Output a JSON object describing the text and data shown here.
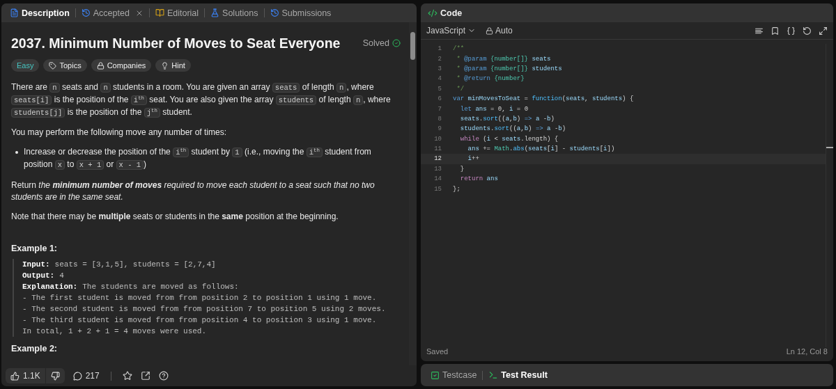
{
  "left_tabs": [
    {
      "kind": "description",
      "label": "Description",
      "selected": true,
      "closable": false
    },
    {
      "kind": "accepted",
      "label": "Accepted",
      "selected": false,
      "closable": true
    },
    {
      "kind": "editorial",
      "label": "Editorial",
      "selected": false,
      "closable": false
    },
    {
      "kind": "solutions",
      "label": "Solutions",
      "selected": false,
      "closable": false
    },
    {
      "kind": "submissions",
      "label": "Submissions",
      "selected": false,
      "closable": false
    }
  ],
  "problem": {
    "title": "2037. Minimum Number of Moves to Seat Everyone",
    "status": "Solved",
    "difficulty": "Easy",
    "chips": [
      {
        "kind": "topics",
        "label": "Topics"
      },
      {
        "kind": "companies",
        "label": "Companies"
      },
      {
        "kind": "hint",
        "label": "Hint"
      }
    ],
    "paragraphs": [
      {
        "kind": "para",
        "segments": [
          {
            "kind": "text",
            "t": "There are "
          },
          {
            "kind": "code",
            "t": "n"
          },
          {
            "kind": "text",
            "t": " seats and "
          },
          {
            "kind": "code",
            "t": "n"
          },
          {
            "kind": "text",
            "t": " students in a room. You are given an array "
          },
          {
            "kind": "code",
            "t": "seats"
          },
          {
            "kind": "text",
            "t": " of length "
          },
          {
            "kind": "code",
            "t": "n"
          },
          {
            "kind": "text",
            "t": ", where "
          },
          {
            "kind": "code",
            "t": "seats[i]"
          },
          {
            "kind": "text",
            "t": " is the position of the "
          },
          {
            "kind": "code",
            "t": "i$^{th}$"
          },
          {
            "kind": "text",
            "t": " seat. You are also given the array "
          },
          {
            "kind": "code",
            "t": "students"
          },
          {
            "kind": "text",
            "t": " of length "
          },
          {
            "kind": "code",
            "t": "n"
          },
          {
            "kind": "text",
            "t": ", where "
          },
          {
            "kind": "code",
            "t": "students[j]"
          },
          {
            "kind": "text",
            "t": " is the position of the "
          },
          {
            "kind": "code",
            "t": "j$^{th}$"
          },
          {
            "kind": "text",
            "t": " student."
          }
        ]
      },
      {
        "kind": "para",
        "segments": [
          {
            "kind": "text",
            "t": "You may perform the following move any number of times:"
          }
        ]
      },
      {
        "kind": "bullet",
        "segments": [
          {
            "kind": "text",
            "t": "Increase or decrease the position of the "
          },
          {
            "kind": "code",
            "t": "i$^{th}$"
          },
          {
            "kind": "text",
            "t": " student by "
          },
          {
            "kind": "code",
            "t": "1"
          },
          {
            "kind": "text",
            "t": " (i.e., moving the "
          },
          {
            "kind": "code",
            "t": "i$^{th}$"
          },
          {
            "kind": "text",
            "t": " student from position "
          },
          {
            "kind": "code",
            "t": "x"
          },
          {
            "kind": "text",
            "t": " to "
          },
          {
            "kind": "code",
            "t": "x + 1"
          },
          {
            "kind": "text",
            "t": " or "
          },
          {
            "kind": "code",
            "t": "x - 1"
          },
          {
            "kind": "text",
            "t": ")"
          }
        ]
      },
      {
        "kind": "para",
        "segments": [
          {
            "kind": "text",
            "t": "Return "
          },
          {
            "kind": "italic",
            "t": "the "
          },
          {
            "kind": "bolditalic",
            "t": "minimum number of moves"
          },
          {
            "kind": "italic",
            "t": " required to move each student to a seat such that no two students are in the same seat."
          }
        ]
      },
      {
        "kind": "para",
        "segments": [
          {
            "kind": "text",
            "t": "Note that there may be "
          },
          {
            "kind": "bold",
            "t": "multiple"
          },
          {
            "kind": "text",
            "t": " seats or students in the "
          },
          {
            "kind": "bold",
            "t": "same"
          },
          {
            "kind": "text",
            "t": " position at the beginning."
          }
        ]
      }
    ],
    "examples": [
      {
        "title": "Example 1:",
        "lines": [
          {
            "label": "Input:",
            "text": "seats = [3,1,5], students = [2,7,4]"
          },
          {
            "label": "Output:",
            "text": "4"
          },
          {
            "label": "Explanation:",
            "text": "The students are moved as follows:"
          },
          {
            "text": "- The first student is moved from from position 2 to position 1 using 1 move."
          },
          {
            "text": "- The second student is moved from from position 7 to position 5 using 2 moves."
          },
          {
            "text": "- The third student is moved from from position 4 to position 3 using 1 move."
          },
          {
            "text": "In total, 1 + 2 + 1 = 4 moves were used."
          }
        ]
      }
    ],
    "next_heading": "Example 2:"
  },
  "footer": {
    "likes": "1.1K",
    "comments": "217"
  },
  "editor": {
    "title": "Code",
    "language": "JavaScript",
    "mode": "Auto",
    "status": "Saved",
    "cursor": "Ln 12, Col 8",
    "lines": [
      {
        "number": "1",
        "current": false,
        "tokens": [
          {
            "kind": "comment",
            "t": "/**"
          }
        ]
      },
      {
        "number": "2",
        "current": false,
        "tokens": [
          {
            "kind": "comment",
            "t": " * "
          },
          {
            "kind": "tag",
            "t": "@param"
          },
          {
            "kind": "type",
            "t": " {number[]}"
          },
          {
            "kind": "var",
            "t": " seats"
          }
        ]
      },
      {
        "number": "3",
        "current": false,
        "tokens": [
          {
            "kind": "comment",
            "t": " * "
          },
          {
            "kind": "tag",
            "t": "@param"
          },
          {
            "kind": "type",
            "t": " {number[]}"
          },
          {
            "kind": "var",
            "t": " students"
          }
        ]
      },
      {
        "number": "4",
        "current": false,
        "tokens": [
          {
            "kind": "comment",
            "t": " * "
          },
          {
            "kind": "tag",
            "t": "@return"
          },
          {
            "kind": "type",
            "t": " {number}"
          }
        ]
      },
      {
        "number": "5",
        "current": false,
        "tokens": [
          {
            "kind": "comment",
            "t": " */"
          }
        ]
      },
      {
        "number": "6",
        "current": false,
        "tokens": [
          {
            "kind": "keyword",
            "t": "var"
          },
          {
            "kind": "var",
            "t": " minMovesToSeat"
          },
          {
            "kind": "plain",
            "t": " = "
          },
          {
            "kind": "fn",
            "t": "function"
          },
          {
            "kind": "plain",
            "t": "("
          },
          {
            "kind": "var",
            "t": "seats"
          },
          {
            "kind": "plain",
            "t": ", "
          },
          {
            "kind": "var",
            "t": "students"
          },
          {
            "kind": "plain",
            "t": ") {"
          }
        ]
      },
      {
        "number": "7",
        "current": false,
        "tokens": [
          {
            "kind": "keyword",
            "t": "  let"
          },
          {
            "kind": "var",
            "t": " ans"
          },
          {
            "kind": "plain",
            "t": " = 0, "
          },
          {
            "kind": "var",
            "t": "i"
          },
          {
            "kind": "plain",
            "t": " = 0"
          }
        ]
      },
      {
        "number": "8",
        "current": false,
        "tokens": [
          {
            "kind": "var",
            "t": "  seats"
          },
          {
            "kind": "plain",
            "t": "."
          },
          {
            "kind": "fn",
            "t": "sort"
          },
          {
            "kind": "plain",
            "t": "(("
          },
          {
            "kind": "var",
            "t": "a"
          },
          {
            "kind": "plain",
            "t": ","
          },
          {
            "kind": "var",
            "t": "b"
          },
          {
            "kind": "plain",
            "t": ") "
          },
          {
            "kind": "keyword",
            "t": "=>"
          },
          {
            "kind": "var",
            "t": " a"
          },
          {
            "kind": "plain",
            "t": " -"
          },
          {
            "kind": "var",
            "t": "b"
          },
          {
            "kind": "plain",
            "t": ")"
          }
        ]
      },
      {
        "number": "9",
        "current": false,
        "tokens": [
          {
            "kind": "var",
            "t": "  students"
          },
          {
            "kind": "plain",
            "t": "."
          },
          {
            "kind": "fn",
            "t": "sort"
          },
          {
            "kind": "plain",
            "t": "(("
          },
          {
            "kind": "var",
            "t": "a"
          },
          {
            "kind": "plain",
            "t": ","
          },
          {
            "kind": "var",
            "t": "b"
          },
          {
            "kind": "plain",
            "t": ") "
          },
          {
            "kind": "keyword",
            "t": "=>"
          },
          {
            "kind": "var",
            "t": " a"
          },
          {
            "kind": "plain",
            "t": " -"
          },
          {
            "kind": "var",
            "t": "b"
          },
          {
            "kind": "plain",
            "t": ")"
          }
        ]
      },
      {
        "number": "10",
        "current": false,
        "tokens": [
          {
            "kind": "control",
            "t": "  while"
          },
          {
            "kind": "plain",
            "t": " ("
          },
          {
            "kind": "var",
            "t": "i"
          },
          {
            "kind": "plain",
            "t": " < "
          },
          {
            "kind": "var",
            "t": "seats"
          },
          {
            "kind": "plain",
            "t": ".length) {"
          }
        ]
      },
      {
        "number": "11",
        "current": false,
        "tokens": [
          {
            "kind": "var",
            "t": "    ans"
          },
          {
            "kind": "plain",
            "t": " += "
          },
          {
            "kind": "class",
            "t": "Math"
          },
          {
            "kind": "plain",
            "t": "."
          },
          {
            "kind": "fn",
            "t": "abs"
          },
          {
            "kind": "plain",
            "t": "("
          },
          {
            "kind": "var",
            "t": "seats"
          },
          {
            "kind": "plain",
            "t": "["
          },
          {
            "kind": "var",
            "t": "i"
          },
          {
            "kind": "plain",
            "t": "] - "
          },
          {
            "kind": "var",
            "t": "students"
          },
          {
            "kind": "plain",
            "t": "["
          },
          {
            "kind": "var",
            "t": "i"
          },
          {
            "kind": "plain",
            "t": "])"
          }
        ]
      },
      {
        "number": "12",
        "current": true,
        "tokens": [
          {
            "kind": "var",
            "t": "    i"
          },
          {
            "kind": "plain",
            "t": "++"
          }
        ]
      },
      {
        "number": "13",
        "current": false,
        "tokens": [
          {
            "kind": "plain",
            "t": "  }"
          }
        ]
      },
      {
        "number": "14",
        "current": false,
        "tokens": [
          {
            "kind": "control",
            "t": "  return"
          },
          {
            "kind": "var",
            "t": " ans"
          }
        ]
      },
      {
        "number": "15",
        "current": false,
        "tokens": [
          {
            "kind": "plain",
            "t": "};"
          }
        ]
      }
    ]
  },
  "bottom_tabs": [
    {
      "kind": "testcase",
      "label": "Testcase",
      "selected": false
    },
    {
      "kind": "result",
      "label": "Test Result",
      "selected": true
    }
  ]
}
